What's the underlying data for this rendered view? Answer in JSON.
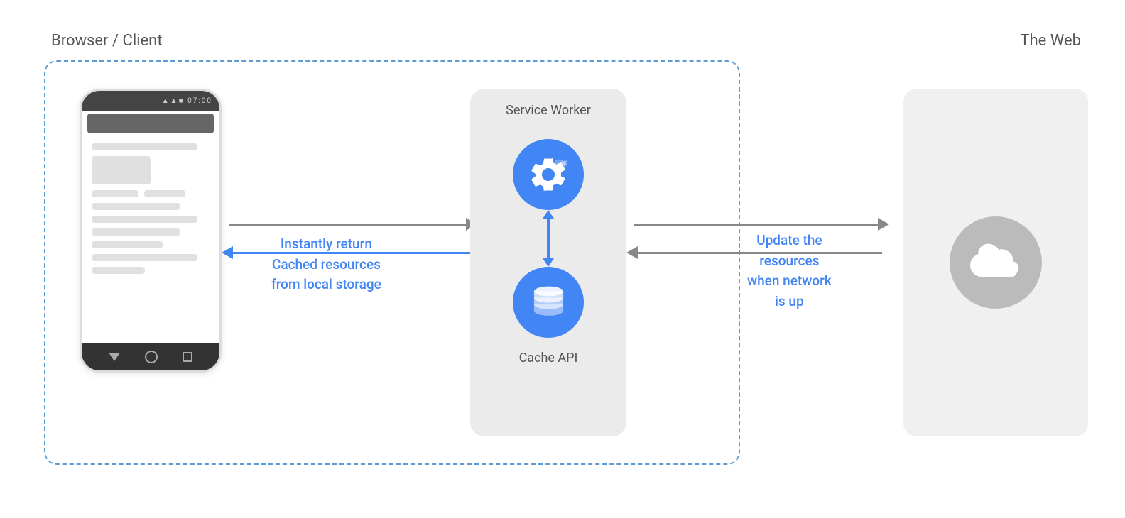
{
  "browserLabel": "Browser / Client",
  "webLabel": "The Web",
  "serviceWorkerLabel": "Service Worker",
  "cacheApiLabel": "Cache API",
  "instantlyReturnLine1": "Instantly return",
  "cachedResourcesLine2": "Cached resources",
  "fromLocalStorageLine3": "from local storage",
  "updateTheLine1": "Update the",
  "resourcesLine2": "resources",
  "whenNetworkLine3": "when network",
  "isUpLine4": "is up",
  "phoneStatus": "▲▲■ 07:00"
}
